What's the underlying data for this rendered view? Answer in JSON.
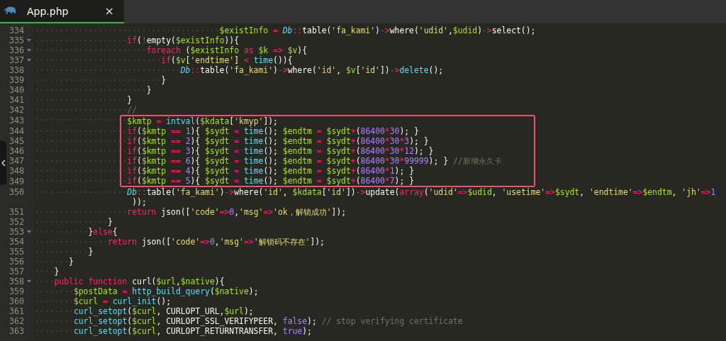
{
  "tabs": [
    {
      "label": "App.php",
      "selected": true,
      "close": "×"
    }
  ],
  "code": {
    "lines": [
      {
        "number": "334",
        "foldable": false,
        "highlighted": false,
        "tokens": [
          {
            "kind": "ws",
            "text": "······································"
          },
          {
            "kind": "var",
            "text": "$existInfo"
          },
          {
            "kind": "op",
            "text": " = "
          },
          {
            "kind": "cls",
            "text": "Db"
          },
          {
            "kind": "op",
            "text": "::"
          },
          {
            "kind": "pl",
            "text": "table("
          },
          {
            "kind": "str",
            "text": "'fa_kami'"
          },
          {
            "kind": "pl",
            "text": ")"
          },
          {
            "kind": "op",
            "text": "->"
          },
          {
            "kind": "pl",
            "text": "where("
          },
          {
            "kind": "str",
            "text": "'udid'"
          },
          {
            "kind": "pl",
            "text": ","
          },
          {
            "kind": "var",
            "text": "$udid"
          },
          {
            "kind": "pl",
            "text": ")"
          },
          {
            "kind": "op",
            "text": "->"
          },
          {
            "kind": "pl",
            "text": "select();"
          }
        ]
      },
      {
        "number": "335",
        "foldable": true,
        "highlighted": false,
        "tokens": [
          {
            "kind": "ws",
            "text": "···················"
          },
          {
            "kind": "kw",
            "text": "if"
          },
          {
            "kind": "pl",
            "text": "("
          },
          {
            "kind": "op",
            "text": "!"
          },
          {
            "kind": "pl",
            "text": "empty("
          },
          {
            "kind": "var",
            "text": "$existInfo"
          },
          {
            "kind": "pl",
            "text": ")){"
          }
        ]
      },
      {
        "number": "336",
        "foldable": true,
        "highlighted": false,
        "tokens": [
          {
            "kind": "ws",
            "text": "·······················"
          },
          {
            "kind": "kw",
            "text": "foreach"
          },
          {
            "kind": "pl",
            "text": " ("
          },
          {
            "kind": "var",
            "text": "$existInfo"
          },
          {
            "kind": "kw",
            "text": " as "
          },
          {
            "kind": "var",
            "text": "$k"
          },
          {
            "kind": "op",
            "text": " => "
          },
          {
            "kind": "var",
            "text": "$v"
          },
          {
            "kind": "pl",
            "text": "){"
          }
        ]
      },
      {
        "number": "337",
        "foldable": true,
        "highlighted": false,
        "tokens": [
          {
            "kind": "ws",
            "text": "··························"
          },
          {
            "kind": "kw",
            "text": "if"
          },
          {
            "kind": "pl",
            "text": "("
          },
          {
            "kind": "var",
            "text": "$v"
          },
          {
            "kind": "pl",
            "text": "["
          },
          {
            "kind": "str",
            "text": "'endtime'"
          },
          {
            "kind": "pl",
            "text": "]"
          },
          {
            "kind": "op",
            "text": " < "
          },
          {
            "kind": "fn",
            "text": "time"
          },
          {
            "kind": "pl",
            "text": "()){"
          }
        ]
      },
      {
        "number": "338",
        "foldable": false,
        "highlighted": false,
        "tokens": [
          {
            "kind": "ws",
            "text": "······························"
          },
          {
            "kind": "cls",
            "text": "Db"
          },
          {
            "kind": "op",
            "text": "::"
          },
          {
            "kind": "pl",
            "text": "table("
          },
          {
            "kind": "str",
            "text": "'fa_kami'"
          },
          {
            "kind": "pl",
            "text": ")"
          },
          {
            "kind": "op",
            "text": "->"
          },
          {
            "kind": "pl",
            "text": "where("
          },
          {
            "kind": "str",
            "text": "'id'"
          },
          {
            "kind": "pl",
            "text": ", "
          },
          {
            "kind": "var",
            "text": "$v"
          },
          {
            "kind": "pl",
            "text": "["
          },
          {
            "kind": "str",
            "text": "'id'"
          },
          {
            "kind": "pl",
            "text": "])"
          },
          {
            "kind": "op",
            "text": "->"
          },
          {
            "kind": "fn",
            "text": "delete"
          },
          {
            "kind": "pl",
            "text": "();"
          }
        ]
      },
      {
        "number": "339",
        "foldable": false,
        "highlighted": false,
        "tokens": [
          {
            "kind": "ws",
            "text": "··························"
          },
          {
            "kind": "pl",
            "text": "}"
          }
        ]
      },
      {
        "number": "340",
        "foldable": false,
        "highlighted": false,
        "tokens": [
          {
            "kind": "ws",
            "text": "·······················"
          },
          {
            "kind": "pl",
            "text": "}"
          }
        ]
      },
      {
        "number": "341",
        "foldable": false,
        "highlighted": false,
        "tokens": [
          {
            "kind": "ws",
            "text": "···················"
          },
          {
            "kind": "pl",
            "text": "}"
          }
        ]
      },
      {
        "number": "342",
        "foldable": false,
        "highlighted": false,
        "tokens": [
          {
            "kind": "ws",
            "text": "···················"
          },
          {
            "kind": "cm",
            "text": "//"
          }
        ]
      },
      {
        "number": "343",
        "foldable": false,
        "highlighted": true,
        "tokens": [
          {
            "kind": "ws",
            "text": "···················"
          },
          {
            "kind": "var",
            "text": "$kmtp"
          },
          {
            "kind": "op",
            "text": " = "
          },
          {
            "kind": "fn",
            "text": "intval"
          },
          {
            "kind": "pl",
            "text": "("
          },
          {
            "kind": "var",
            "text": "$kdata"
          },
          {
            "kind": "pl",
            "text": "["
          },
          {
            "kind": "str",
            "text": "'kmyp'"
          },
          {
            "kind": "pl",
            "text": "]);"
          }
        ]
      },
      {
        "number": "344",
        "foldable": false,
        "highlighted": true,
        "tokens": [
          {
            "kind": "ws",
            "text": "···················"
          },
          {
            "kind": "kw",
            "text": "if"
          },
          {
            "kind": "pl",
            "text": "("
          },
          {
            "kind": "var",
            "text": "$kmtp"
          },
          {
            "kind": "op",
            "text": " == "
          },
          {
            "kind": "num",
            "text": "1"
          },
          {
            "kind": "pl",
            "text": "){ "
          },
          {
            "kind": "var",
            "text": "$sydt"
          },
          {
            "kind": "op",
            "text": " = "
          },
          {
            "kind": "fn",
            "text": "time"
          },
          {
            "kind": "pl",
            "text": "(); "
          },
          {
            "kind": "var",
            "text": "$endtm"
          },
          {
            "kind": "op",
            "text": " = "
          },
          {
            "kind": "var",
            "text": "$sydt"
          },
          {
            "kind": "op",
            "text": "+"
          },
          {
            "kind": "pl",
            "text": "("
          },
          {
            "kind": "num",
            "text": "86400"
          },
          {
            "kind": "op",
            "text": "*"
          },
          {
            "kind": "num",
            "text": "30"
          },
          {
            "kind": "pl",
            "text": "); }"
          }
        ]
      },
      {
        "number": "345",
        "foldable": false,
        "highlighted": true,
        "tokens": [
          {
            "kind": "ws",
            "text": "···················"
          },
          {
            "kind": "kw",
            "text": "if"
          },
          {
            "kind": "pl",
            "text": "("
          },
          {
            "kind": "var",
            "text": "$kmtp"
          },
          {
            "kind": "op",
            "text": " == "
          },
          {
            "kind": "num",
            "text": "2"
          },
          {
            "kind": "pl",
            "text": "){ "
          },
          {
            "kind": "var",
            "text": "$sydt"
          },
          {
            "kind": "op",
            "text": " = "
          },
          {
            "kind": "fn",
            "text": "time"
          },
          {
            "kind": "pl",
            "text": "(); "
          },
          {
            "kind": "var",
            "text": "$endtm"
          },
          {
            "kind": "op",
            "text": " = "
          },
          {
            "kind": "var",
            "text": "$sydt"
          },
          {
            "kind": "op",
            "text": "+"
          },
          {
            "kind": "pl",
            "text": "("
          },
          {
            "kind": "num",
            "text": "86400"
          },
          {
            "kind": "op",
            "text": "*"
          },
          {
            "kind": "num",
            "text": "30"
          },
          {
            "kind": "op",
            "text": "*"
          },
          {
            "kind": "num",
            "text": "3"
          },
          {
            "kind": "pl",
            "text": "); }"
          }
        ]
      },
      {
        "number": "346",
        "foldable": false,
        "highlighted": true,
        "tokens": [
          {
            "kind": "ws",
            "text": "···················"
          },
          {
            "kind": "kw",
            "text": "if"
          },
          {
            "kind": "pl",
            "text": "("
          },
          {
            "kind": "var",
            "text": "$kmtp"
          },
          {
            "kind": "op",
            "text": " == "
          },
          {
            "kind": "num",
            "text": "3"
          },
          {
            "kind": "pl",
            "text": "){ "
          },
          {
            "kind": "var",
            "text": "$sydt"
          },
          {
            "kind": "op",
            "text": " = "
          },
          {
            "kind": "fn",
            "text": "time"
          },
          {
            "kind": "pl",
            "text": "(); "
          },
          {
            "kind": "var",
            "text": "$endtm"
          },
          {
            "kind": "op",
            "text": " = "
          },
          {
            "kind": "var",
            "text": "$sydt"
          },
          {
            "kind": "op",
            "text": "+"
          },
          {
            "kind": "pl",
            "text": "("
          },
          {
            "kind": "num",
            "text": "86400"
          },
          {
            "kind": "op",
            "text": "*"
          },
          {
            "kind": "num",
            "text": "30"
          },
          {
            "kind": "op",
            "text": "*"
          },
          {
            "kind": "num",
            "text": "12"
          },
          {
            "kind": "pl",
            "text": "); }"
          }
        ]
      },
      {
        "number": "347",
        "foldable": false,
        "highlighted": true,
        "tokens": [
          {
            "kind": "ws",
            "text": "···················"
          },
          {
            "kind": "kw",
            "text": "if"
          },
          {
            "kind": "pl",
            "text": "("
          },
          {
            "kind": "var",
            "text": "$kmtp"
          },
          {
            "kind": "op",
            "text": " == "
          },
          {
            "kind": "num",
            "text": "6"
          },
          {
            "kind": "pl",
            "text": "){ "
          },
          {
            "kind": "var",
            "text": "$sydt"
          },
          {
            "kind": "op",
            "text": " = "
          },
          {
            "kind": "fn",
            "text": "time"
          },
          {
            "kind": "pl",
            "text": "(); "
          },
          {
            "kind": "var",
            "text": "$endtm"
          },
          {
            "kind": "op",
            "text": " = "
          },
          {
            "kind": "var",
            "text": "$sydt"
          },
          {
            "kind": "op",
            "text": "+"
          },
          {
            "kind": "pl",
            "text": "("
          },
          {
            "kind": "num",
            "text": "86400"
          },
          {
            "kind": "op",
            "text": "*"
          },
          {
            "kind": "num",
            "text": "30"
          },
          {
            "kind": "op",
            "text": "*"
          },
          {
            "kind": "num",
            "text": "99999"
          },
          {
            "kind": "pl",
            "text": "); } "
          },
          {
            "kind": "cm",
            "text": "//新增永久卡"
          }
        ]
      },
      {
        "number": "348",
        "foldable": false,
        "highlighted": true,
        "tokens": [
          {
            "kind": "ws",
            "text": "···················"
          },
          {
            "kind": "kw",
            "text": "if"
          },
          {
            "kind": "pl",
            "text": "("
          },
          {
            "kind": "var",
            "text": "$kmtp"
          },
          {
            "kind": "op",
            "text": " == "
          },
          {
            "kind": "num",
            "text": "4"
          },
          {
            "kind": "pl",
            "text": "){ "
          },
          {
            "kind": "var",
            "text": "$sydt"
          },
          {
            "kind": "op",
            "text": " = "
          },
          {
            "kind": "fn",
            "text": "time"
          },
          {
            "kind": "pl",
            "text": "(); "
          },
          {
            "kind": "var",
            "text": "$endtm"
          },
          {
            "kind": "op",
            "text": " = "
          },
          {
            "kind": "var",
            "text": "$sydt"
          },
          {
            "kind": "op",
            "text": "+"
          },
          {
            "kind": "pl",
            "text": "("
          },
          {
            "kind": "num",
            "text": "86400"
          },
          {
            "kind": "op",
            "text": "*"
          },
          {
            "kind": "num",
            "text": "1"
          },
          {
            "kind": "pl",
            "text": "); }"
          }
        ]
      },
      {
        "number": "349",
        "foldable": false,
        "highlighted": true,
        "tokens": [
          {
            "kind": "ws",
            "text": "···················"
          },
          {
            "kind": "kw",
            "text": "if"
          },
          {
            "kind": "pl",
            "text": "("
          },
          {
            "kind": "var",
            "text": "$kmtp"
          },
          {
            "kind": "op",
            "text": " == "
          },
          {
            "kind": "num",
            "text": "5"
          },
          {
            "kind": "pl",
            "text": "){ "
          },
          {
            "kind": "var",
            "text": "$sydt"
          },
          {
            "kind": "op",
            "text": " = "
          },
          {
            "kind": "fn",
            "text": "time"
          },
          {
            "kind": "pl",
            "text": "(); "
          },
          {
            "kind": "var",
            "text": "$endtm"
          },
          {
            "kind": "op",
            "text": " = "
          },
          {
            "kind": "var",
            "text": "$sydt"
          },
          {
            "kind": "op",
            "text": "+"
          },
          {
            "kind": "pl",
            "text": "("
          },
          {
            "kind": "num",
            "text": "86400"
          },
          {
            "kind": "op",
            "text": "*"
          },
          {
            "kind": "num",
            "text": "7"
          },
          {
            "kind": "pl",
            "text": "); }"
          }
        ]
      },
      {
        "number": "350",
        "foldable": false,
        "highlighted": false,
        "tokens": [
          {
            "kind": "ws",
            "text": "···················"
          },
          {
            "kind": "cls",
            "text": "Db"
          },
          {
            "kind": "op",
            "text": "::"
          },
          {
            "kind": "pl",
            "text": "table("
          },
          {
            "kind": "str",
            "text": "'fa_kami'"
          },
          {
            "kind": "pl",
            "text": ")"
          },
          {
            "kind": "op",
            "text": "->"
          },
          {
            "kind": "pl",
            "text": "where("
          },
          {
            "kind": "str",
            "text": "'id'"
          },
          {
            "kind": "pl",
            "text": ", "
          },
          {
            "kind": "var",
            "text": "$kdata"
          },
          {
            "kind": "pl",
            "text": "["
          },
          {
            "kind": "str",
            "text": "'id'"
          },
          {
            "kind": "pl",
            "text": "])"
          },
          {
            "kind": "op",
            "text": "->"
          },
          {
            "kind": "pl",
            "text": "update("
          },
          {
            "kind": "kw",
            "text": "array"
          },
          {
            "kind": "pl",
            "text": "("
          },
          {
            "kind": "str",
            "text": "'udid'"
          },
          {
            "kind": "op",
            "text": "=>"
          },
          {
            "kind": "var",
            "text": "$udid"
          },
          {
            "kind": "pl",
            "text": ", "
          },
          {
            "kind": "str",
            "text": "'usetime'"
          },
          {
            "kind": "op",
            "text": "=>"
          },
          {
            "kind": "var",
            "text": "$sydt"
          },
          {
            "kind": "pl",
            "text": ", "
          },
          {
            "kind": "str",
            "text": "'endtime'"
          },
          {
            "kind": "op",
            "text": "=>"
          },
          {
            "kind": "var",
            "text": "$endtm"
          },
          {
            "kind": "pl",
            "text": ", "
          },
          {
            "kind": "str",
            "text": "'jh'"
          },
          {
            "kind": "op",
            "text": "=>"
          },
          {
            "kind": "num",
            "text": "1"
          }
        ]
      },
      {
        "foldable": false,
        "highlighted": false,
        "wrapped": true,
        "tokens": [
          {
            "kind": "pl",
            "text": "));"
          }
        ]
      },
      {
        "number": "351",
        "foldable": false,
        "highlighted": false,
        "tokens": [
          {
            "kind": "ws",
            "text": "···················"
          },
          {
            "kind": "kw",
            "text": "return"
          },
          {
            "kind": "pl",
            "text": " json(["
          },
          {
            "kind": "str",
            "text": "'code'"
          },
          {
            "kind": "op",
            "text": "=>"
          },
          {
            "kind": "num",
            "text": "0"
          },
          {
            "kind": "pl",
            "text": ","
          },
          {
            "kind": "str",
            "text": "'msg'"
          },
          {
            "kind": "op",
            "text": "=>"
          },
          {
            "kind": "str",
            "text": "'ok，解锁成功'"
          },
          {
            "kind": "pl",
            "text": "]);"
          }
        ]
      },
      {
        "number": "352",
        "foldable": false,
        "highlighted": false,
        "tokens": [
          {
            "kind": "ws",
            "text": "···············"
          },
          {
            "kind": "pl",
            "text": "}"
          }
        ]
      },
      {
        "number": "353",
        "foldable": true,
        "highlighted": false,
        "tokens": [
          {
            "kind": "ws",
            "text": "···········"
          },
          {
            "kind": "pl",
            "text": "}"
          },
          {
            "kind": "kw",
            "text": "else"
          },
          {
            "kind": "pl",
            "text": "{"
          }
        ]
      },
      {
        "number": "354",
        "foldable": false,
        "highlighted": false,
        "tokens": [
          {
            "kind": "ws",
            "text": "···············"
          },
          {
            "kind": "kw",
            "text": "return"
          },
          {
            "kind": "pl",
            "text": " json(["
          },
          {
            "kind": "str",
            "text": "'code'"
          },
          {
            "kind": "op",
            "text": "=>"
          },
          {
            "kind": "num",
            "text": "0"
          },
          {
            "kind": "pl",
            "text": ","
          },
          {
            "kind": "str",
            "text": "'msg'"
          },
          {
            "kind": "op",
            "text": "=>"
          },
          {
            "kind": "str",
            "text": "'解锁码不存在'"
          },
          {
            "kind": "pl",
            "text": "]);"
          }
        ]
      },
      {
        "number": "355",
        "foldable": false,
        "highlighted": false,
        "tokens": [
          {
            "kind": "ws",
            "text": "···········"
          },
          {
            "kind": "pl",
            "text": "}"
          }
        ]
      },
      {
        "number": "356",
        "foldable": false,
        "highlighted": false,
        "tokens": [
          {
            "kind": "ws",
            "text": "·······"
          },
          {
            "kind": "pl",
            "text": "}"
          }
        ]
      },
      {
        "number": "357",
        "foldable": false,
        "highlighted": false,
        "tokens": [
          {
            "kind": "ws",
            "text": "····"
          },
          {
            "kind": "pl",
            "text": "}"
          }
        ]
      },
      {
        "number": "358",
        "foldable": true,
        "highlighted": false,
        "tokens": [
          {
            "kind": "ws",
            "text": "····"
          },
          {
            "kind": "kw",
            "text": "public function"
          },
          {
            "kind": "pl",
            "text": " curl("
          },
          {
            "kind": "var",
            "text": "$url"
          },
          {
            "kind": "pl",
            "text": ","
          },
          {
            "kind": "var",
            "text": "$native"
          },
          {
            "kind": "pl",
            "text": "){"
          }
        ]
      },
      {
        "number": "359",
        "foldable": false,
        "highlighted": false,
        "tokens": [
          {
            "kind": "ws",
            "text": "········"
          },
          {
            "kind": "var",
            "text": "$postData"
          },
          {
            "kind": "op",
            "text": " = "
          },
          {
            "kind": "fn",
            "text": "http_build_query"
          },
          {
            "kind": "pl",
            "text": "("
          },
          {
            "kind": "var",
            "text": "$native"
          },
          {
            "kind": "pl",
            "text": ");"
          }
        ]
      },
      {
        "number": "360",
        "foldable": false,
        "highlighted": false,
        "tokens": [
          {
            "kind": "ws",
            "text": "········"
          },
          {
            "kind": "var",
            "text": "$curl"
          },
          {
            "kind": "op",
            "text": " = "
          },
          {
            "kind": "fn",
            "text": "curl_init"
          },
          {
            "kind": "pl",
            "text": "();"
          }
        ]
      },
      {
        "number": "361",
        "foldable": false,
        "highlighted": false,
        "tokens": [
          {
            "kind": "ws",
            "text": "········"
          },
          {
            "kind": "fn",
            "text": "curl_setopt"
          },
          {
            "kind": "pl",
            "text": "("
          },
          {
            "kind": "var",
            "text": "$curl"
          },
          {
            "kind": "pl",
            "text": ", CURLOPT_URL,"
          },
          {
            "kind": "var",
            "text": "$url"
          },
          {
            "kind": "pl",
            "text": ");"
          }
        ]
      },
      {
        "number": "362",
        "foldable": false,
        "highlighted": false,
        "tokens": [
          {
            "kind": "ws",
            "text": "········"
          },
          {
            "kind": "fn",
            "text": "curl_setopt"
          },
          {
            "kind": "pl",
            "text": "("
          },
          {
            "kind": "var",
            "text": "$curl"
          },
          {
            "kind": "pl",
            "text": ", CURLOPT_SSL_VERIFYPEER, "
          },
          {
            "kind": "cn",
            "text": "false"
          },
          {
            "kind": "pl",
            "text": "); "
          },
          {
            "kind": "cm",
            "text": "// stop verifying certificate"
          }
        ]
      },
      {
        "number": "363",
        "foldable": false,
        "highlighted": false,
        "tokens": [
          {
            "kind": "ws",
            "text": "········"
          },
          {
            "kind": "fn",
            "text": "curl_setopt"
          },
          {
            "kind": "pl",
            "text": "("
          },
          {
            "kind": "var",
            "text": "$curl"
          },
          {
            "kind": "pl",
            "text": ", CURLOPT_RETURNTRANSFER, "
          },
          {
            "kind": "cn",
            "text": "true"
          },
          {
            "kind": "pl",
            "text": ");"
          }
        ]
      }
    ]
  }
}
